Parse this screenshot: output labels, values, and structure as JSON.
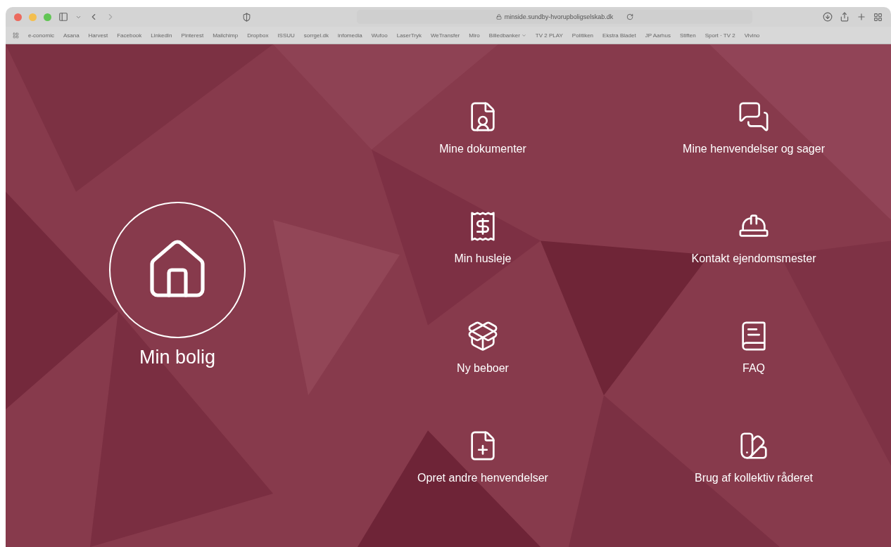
{
  "browser": {
    "address": "minside.sundby-hvorupboligselskab.dk",
    "bookmarks": [
      {
        "label": "e-conomic",
        "dropdown": false
      },
      {
        "label": "Asana",
        "dropdown": false
      },
      {
        "label": "Harvest",
        "dropdown": false
      },
      {
        "label": "Facebook",
        "dropdown": false
      },
      {
        "label": "LinkedIn",
        "dropdown": false
      },
      {
        "label": "Pinterest",
        "dropdown": false
      },
      {
        "label": "Mailchimp",
        "dropdown": false
      },
      {
        "label": "Dropbox",
        "dropdown": false
      },
      {
        "label": "ISSUU",
        "dropdown": false
      },
      {
        "label": "sorrgel.dk",
        "dropdown": false
      },
      {
        "label": "infomedia",
        "dropdown": false
      },
      {
        "label": "Wufoo",
        "dropdown": false
      },
      {
        "label": "LaserTryk",
        "dropdown": false
      },
      {
        "label": "WeTransfer",
        "dropdown": false
      },
      {
        "label": "Miro",
        "dropdown": false
      },
      {
        "label": "Billedbanker",
        "dropdown": true
      },
      {
        "label": "TV 2 PLAY",
        "dropdown": false
      },
      {
        "label": "Politiken",
        "dropdown": false
      },
      {
        "label": "Ekstra Bladet",
        "dropdown": false
      },
      {
        "label": "JP Aarhus",
        "dropdown": false
      },
      {
        "label": "Stiften",
        "dropdown": false
      },
      {
        "label": "Sport · TV 2",
        "dropdown": false
      },
      {
        "label": "Vivino",
        "dropdown": false
      }
    ]
  },
  "hero": {
    "label": "Min bolig"
  },
  "tiles": [
    {
      "label": "Mine dokumenter"
    },
    {
      "label": "Mine henvendelser og sager"
    },
    {
      "label": "Min husleje"
    },
    {
      "label": "Kontakt ejendomsmester"
    },
    {
      "label": "Ny beboer"
    },
    {
      "label": "FAQ"
    },
    {
      "label": "Opret andre henvendelser"
    },
    {
      "label": "Brug af kollektiv råderet"
    }
  ]
}
